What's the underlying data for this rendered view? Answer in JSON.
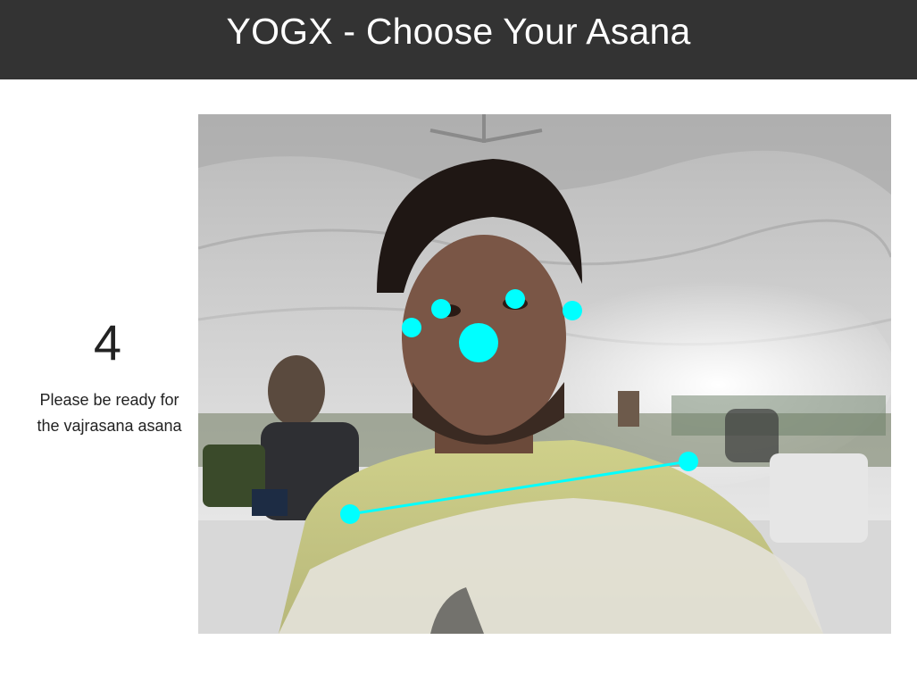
{
  "header": {
    "title": "YOGX - Choose Your Asana"
  },
  "countdown": {
    "value": "4",
    "message": "Please be ready for the vajrasana asana"
  },
  "camera": {
    "overlay_color": "#00ffff",
    "keypoints": [
      "left-eye",
      "right-eye",
      "left-ear",
      "right-ear",
      "nose",
      "left-shoulder",
      "right-shoulder"
    ]
  }
}
